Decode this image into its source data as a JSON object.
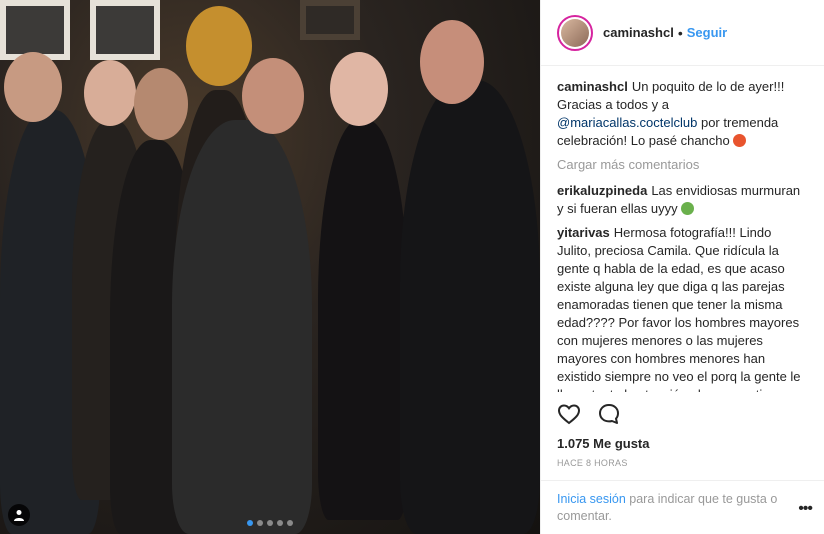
{
  "post": {
    "username": "caminashcl",
    "separator": "•",
    "follow_label": "Seguir"
  },
  "caption": {
    "user": "caminashcl",
    "text_before": "Un poquito de lo de ayer!!! Gracias a todos y a ",
    "mention": "@mariacallas.coctelclub",
    "text_after": " por tremenda celebración! Lo pasé chancho "
  },
  "load_more_label": "Cargar más comentarios",
  "comments": [
    {
      "user": "erikaluzpineda",
      "text": "Las envidiosas murmuran y si fueran ellas uyyy "
    },
    {
      "user": "yitarivas",
      "text": "Hermosa fotografía!!! Lindo Julito, preciosa Camila. Que ridícula la gente q habla de la edad, es que acaso existe alguna ley que diga q las parejas enamoradas tienen que tener la misma edad???? Por favor los hombres mayores con mujeres menores o las mujeres mayores con hombres menores han existido siempre no veo el porq la gente le llama tanto la atención el amor no tiene q ver con la edad...."
    }
  ],
  "actions": {
    "like_icon": "heart-icon",
    "comment_icon": "comment-icon"
  },
  "likes_label": "1.075 Me gusta",
  "time_label": "HACE 8 HORAS",
  "footer": {
    "login_label": "Inicia sesión",
    "text": " para indicar que te gusta o comentar."
  },
  "more_icon": "more-options-icon",
  "colors": {
    "link": "#3897f0",
    "mention": "#003569",
    "muted": "#999999"
  }
}
